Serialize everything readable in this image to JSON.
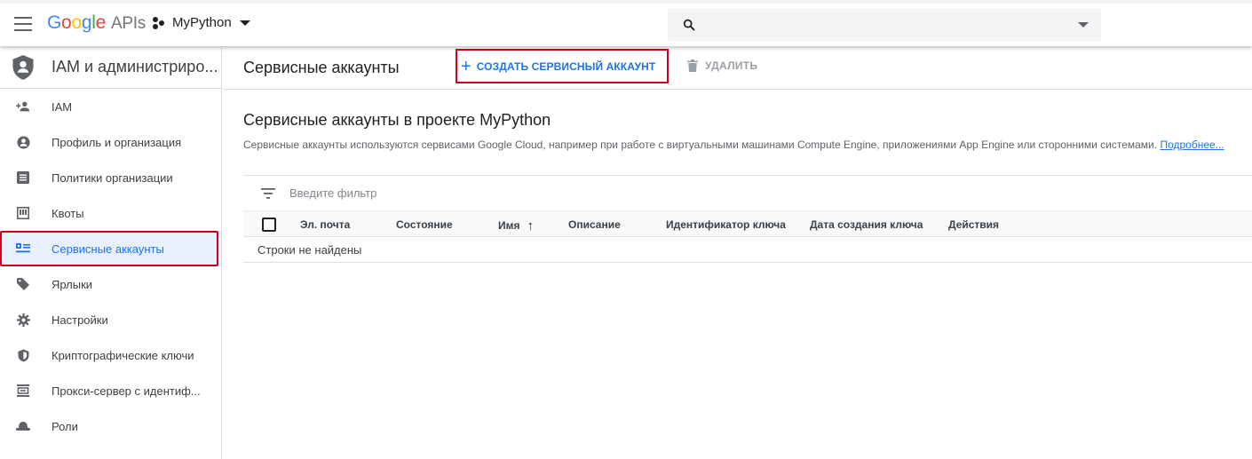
{
  "header": {
    "logo_google": "Google",
    "logo_apis": "APIs",
    "project_name": "MyPython",
    "search_placeholder": ""
  },
  "sidebar": {
    "title": "IAM и администриро...",
    "items": [
      {
        "label": "IAM",
        "icon": "person-add-icon"
      },
      {
        "label": "Профиль и организация",
        "icon": "account-circle-icon"
      },
      {
        "label": "Политики организации",
        "icon": "list-alt-icon"
      },
      {
        "label": "Квоты",
        "icon": "quota-icon"
      },
      {
        "label": "Сервисные аккаунты",
        "icon": "service-account-icon",
        "active": true
      },
      {
        "label": "Ярлыки",
        "icon": "label-tag-icon"
      },
      {
        "label": "Настройки",
        "icon": "gear-icon"
      },
      {
        "label": "Криптографические ключи",
        "icon": "security-shield-icon"
      },
      {
        "label": "Прокси-сервер с идентиф...",
        "icon": "proxy-icon"
      },
      {
        "label": "Роли",
        "icon": "hat-icon"
      }
    ]
  },
  "toolbar": {
    "page_title": "Сервисные аккаунты",
    "create_label": "СОЗДАТЬ СЕРВИСНЫЙ АККАУНТ",
    "delete_label": "УДАЛИТЬ"
  },
  "main": {
    "section_title": "Сервисные аккаунты в проекте MyPython",
    "description": "Сервисные аккаунты используются сервисами Google Cloud, например при работе с виртуальными машинами Compute Engine, приложениями App Engine или сторонними системами.",
    "learn_more": "Подробнее...",
    "filter_placeholder": "Введите фильтр",
    "table": {
      "columns": [
        "Эл. почта",
        "Состояние",
        "Имя",
        "Описание",
        "Идентификатор ключа",
        "Дата создания ключа",
        "Действия"
      ],
      "sorted_column": "Имя",
      "sort_direction": "ascending",
      "empty_text": "Строки не найдены"
    }
  },
  "colors": {
    "accent": "#1a73e8",
    "highlight_box": "#d0021b",
    "active_bg": "#e8f0fe"
  }
}
